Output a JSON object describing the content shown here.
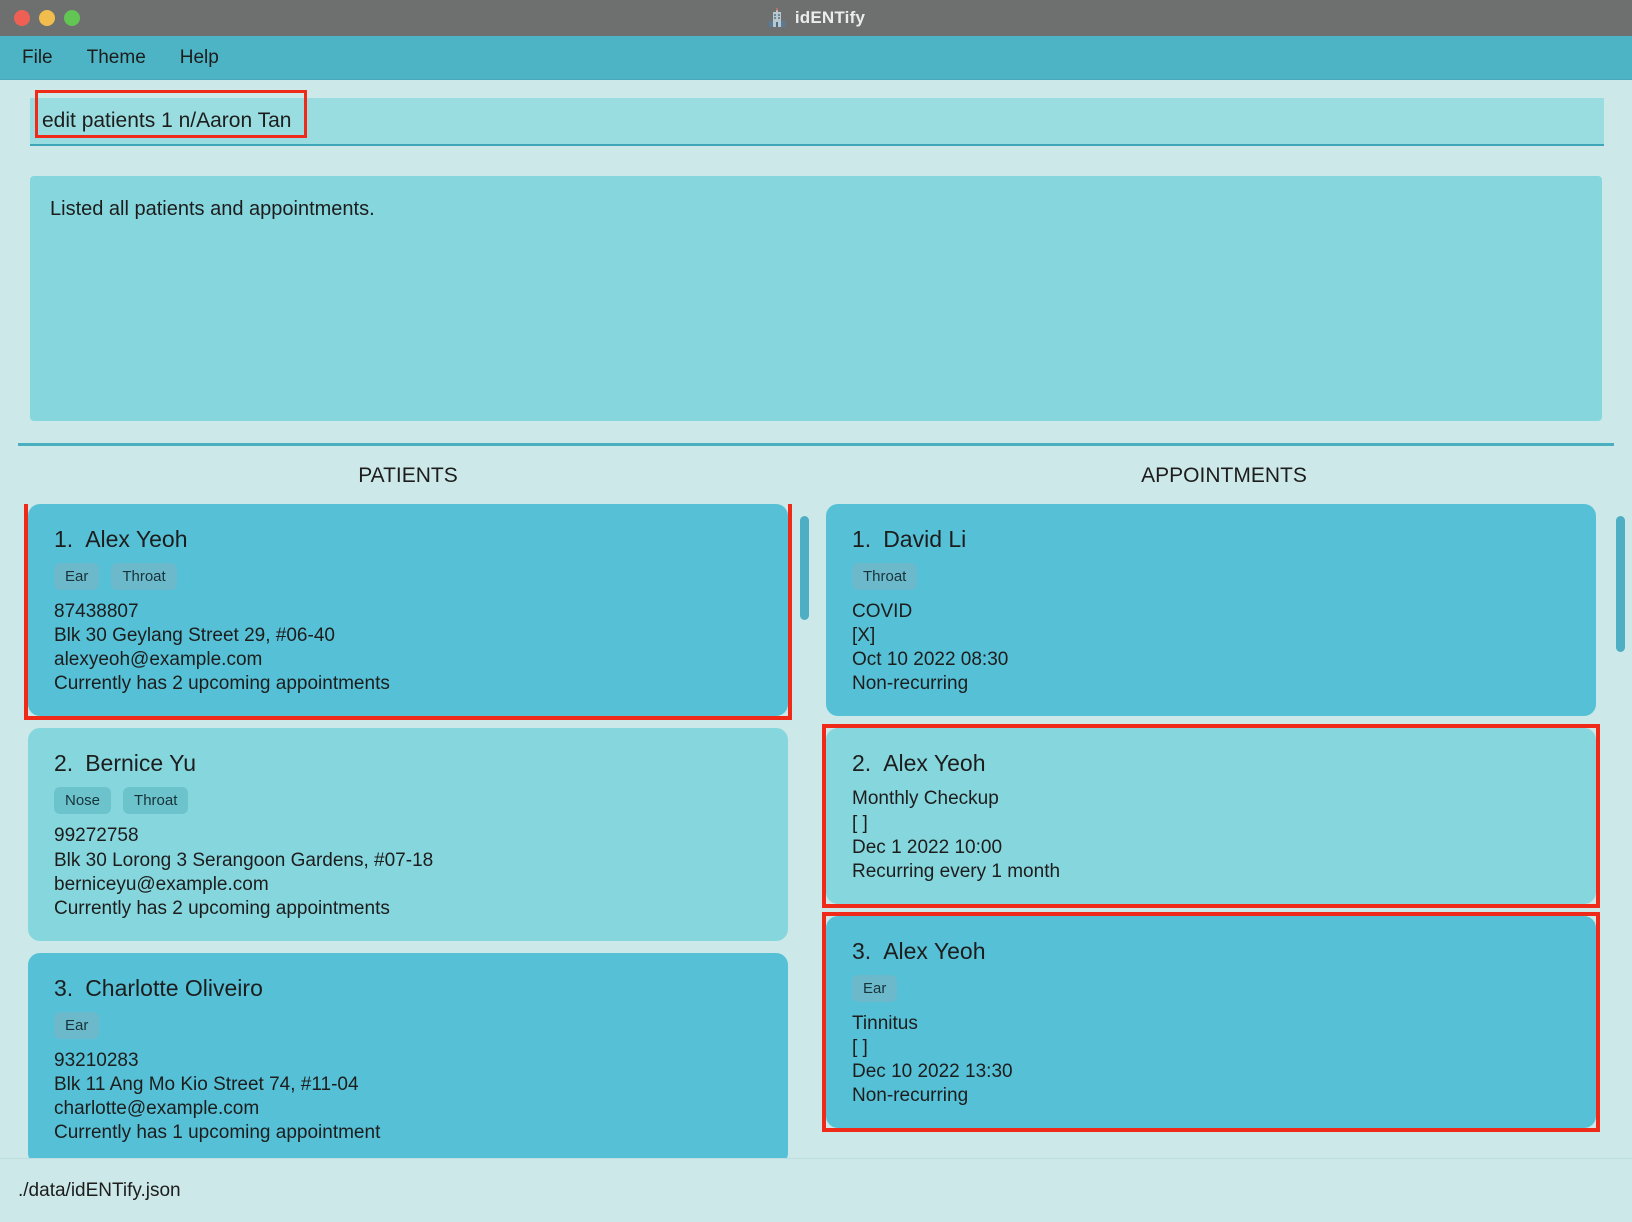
{
  "window": {
    "title": "idENTify",
    "app_icon": "hospital-icon",
    "traffic_lights": [
      "close",
      "minimize",
      "maximize"
    ]
  },
  "menubar": {
    "items": [
      {
        "label": "File"
      },
      {
        "label": "Theme"
      },
      {
        "label": "Help"
      }
    ]
  },
  "command": {
    "value": "edit patients 1 n/Aaron Tan",
    "placeholder": "Enter command here...",
    "highlighted": true
  },
  "result": {
    "text": "Listed all patients and appointments."
  },
  "panels": {
    "patients": {
      "title": "PATIENTS",
      "cards": [
        {
          "index": "1.",
          "name": "Alex Yeoh",
          "tags": [
            "Ear",
            "Throat"
          ],
          "phone": "87438807",
          "address": "Blk 30 Geylang Street 29, #06-40",
          "email": "alexyeoh@example.com",
          "appointments": "Currently has 2 upcoming appointments",
          "selected": true,
          "highlighted": true
        },
        {
          "index": "2.",
          "name": "Bernice Yu",
          "tags": [
            "Nose",
            "Throat"
          ],
          "phone": "99272758",
          "address": "Blk 30 Lorong 3 Serangoon Gardens, #07-18",
          "email": "berniceyu@example.com",
          "appointments": "Currently has 2 upcoming appointments",
          "selected": false,
          "highlighted": false
        },
        {
          "index": "3.",
          "name": "Charlotte Oliveiro",
          "tags": [
            "Ear"
          ],
          "phone": "93210283",
          "address": "Blk 11 Ang Mo Kio Street 74, #11-04",
          "email": "charlotte@example.com",
          "appointments": "Currently has 1 upcoming appointment",
          "selected": true,
          "highlighted": false
        }
      ]
    },
    "appointments": {
      "title": "APPOINTMENTS",
      "cards": [
        {
          "index": "1.",
          "name": "David Li",
          "tags": [
            "Throat"
          ],
          "reason": "COVID",
          "status": "[X]",
          "datetime": "Oct 10 2022 08:30",
          "recurrence": "Non-recurring",
          "selected": true,
          "highlighted": false
        },
        {
          "index": "2.",
          "name": "Alex Yeoh",
          "tags": [],
          "reason": "Monthly Checkup",
          "status": "[ ]",
          "datetime": "Dec 1 2022 10:00",
          "recurrence": "Recurring every 1 month",
          "selected": false,
          "highlighted": true
        },
        {
          "index": "3.",
          "name": "Alex Yeoh",
          "tags": [
            "Ear"
          ],
          "reason": "Tinnitus",
          "status": "[ ]",
          "datetime": "Dec 10 2022 13:30",
          "recurrence": "Non-recurring",
          "selected": true,
          "highlighted": true
        }
      ]
    }
  },
  "statusbar": {
    "path": "./data/idENTify.json"
  },
  "colors": {
    "titlebar": "#6e7070",
    "menubar": "#4cb4c4",
    "background": "#cce8e8",
    "card_selected": "#55c0d6",
    "card_unselected": "#85d6dd",
    "tag": "#6cb9cc",
    "divider": "#4cafc0",
    "highlight": "#ef2a18",
    "scrollbar_thumb": "#4eafc4"
  }
}
